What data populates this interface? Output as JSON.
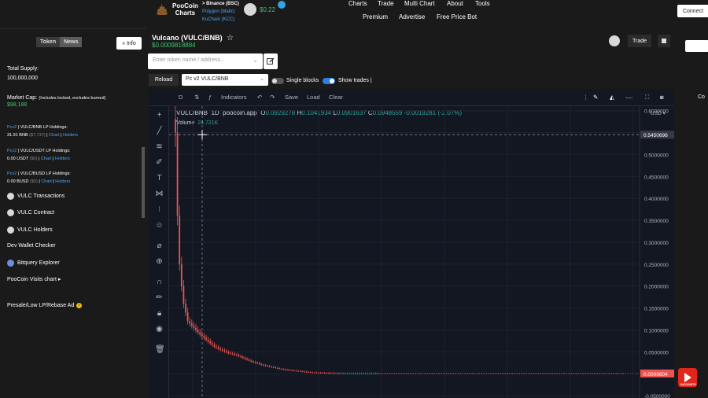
{
  "nav": {
    "logo_line1": "PooCoin",
    "logo_line2": "Charts",
    "chain_bsc": "> Binance (BSC)",
    "chain_polygon": "Polygon (Matic)",
    "chain_kucoin": "KuChain (KCC)",
    "poo_price": "$0.22",
    "links": [
      "Charts",
      "Trade",
      "Multi Chart",
      "About",
      "Tools",
      "Premium",
      "Advertise",
      "Free Price Bot"
    ],
    "connect_label": "Connect"
  },
  "sidebar": {
    "tab_token": "Token",
    "tab_news": "News",
    "info_label": "Info",
    "total_supply_label": "Total Supply:",
    "total_supply_value": "100,000,000",
    "market_cap_label": "Market Cap:",
    "market_cap_note": "(Includes locked, excludes burned)",
    "market_cap_value": "$98,188",
    "holdings": [
      {
        "version": "Pcv2",
        "pair": " | VULC/BNB LP Holdings:",
        "amount": "31.91 BNB",
        "usd": " ($7,737)",
        "chart": "Chart",
        "holders": "Holders"
      },
      {
        "version": "Pcv2",
        "pair": " | VULC/USDT LP Holdings:",
        "amount": "0.00 USDT",
        "usd": " ($0)",
        "chart": "Chart",
        "holders": "Holders"
      },
      {
        "version": "Pcv2",
        "pair": " | VULC/BUSD LP Holdings:",
        "amount": "0.00 BUSD",
        "usd": " ($0)",
        "chart": "Chart",
        "holders": "Holders"
      }
    ],
    "links": {
      "transactions": "VULC Transactions",
      "contract": "VULC Contract",
      "holders": "VULC Holders",
      "dev_wallet": "Dev Wallet Checker",
      "bitquery": "Bitquery Explorer",
      "visits": "PooCoin Visits chart",
      "presale": "Presale/Low LP/Rebase Ad"
    }
  },
  "header": {
    "token_title": "Vulcano (VULC/BNB)",
    "token_price": "$0.0009818884",
    "search_placeholder": "Enter token name / address...",
    "reload_label": "Reload",
    "pair_value": "Pc v2 VULC/BNB",
    "single_blocks_label": "Single blocks",
    "show_trades_label": "Show trades |",
    "trade_label": "Trade"
  },
  "right_panel": {
    "partial_text": "Co"
  },
  "video_badge": "INCOGNITO",
  "chart_toolbar": {
    "interval": "D",
    "indicators": "Indicators",
    "save": "Save",
    "load": "Load",
    "clear": "Clear"
  },
  "chart_data": {
    "type": "candlestick",
    "symbol": "VULC/BNB",
    "interval": "1D",
    "source": "poocoin.app",
    "ohlc": {
      "O": "0.0929278",
      "H": "0.1041934",
      "L": "0.0901637",
      "C": "0.0948559",
      "change": "-0.0019281 (-2.07%)"
    },
    "volume_label": "Volume",
    "volume_value": "24.721K",
    "y_axis_unit": "USD",
    "y_ticks": [
      0.6,
      0.55,
      0.5,
      0.45,
      0.4,
      0.35,
      0.3,
      0.25,
      0.2,
      0.15,
      0.1,
      0.05,
      0.0,
      -0.05
    ],
    "y_tick_labels": [
      "0.6000000",
      "0.5500000",
      "0.5000000",
      "0.4500000",
      "0.4000000",
      "0.3500000",
      "0.3000000",
      "0.2500000",
      "0.2000000",
      "0.1500000",
      "0.1000000",
      "0.0500000",
      "0.0000000",
      "-0.0500000"
    ],
    "ylim": [
      -0.055,
      0.61
    ],
    "crosshair_value": 0.5450696,
    "crosshair_label": "0.5450696",
    "last_price": 0.0009804,
    "last_price_label": "0.0009804",
    "series_close": [
      0.55,
      0.36,
      0.25,
      0.2,
      0.16,
      0.14,
      0.12,
      0.115,
      0.11,
      0.105,
      0.1,
      0.095,
      0.09,
      0.086,
      0.082,
      0.078,
      0.074,
      0.07,
      0.066,
      0.062,
      0.06,
      0.057,
      0.055,
      0.053,
      0.051,
      0.049,
      0.047,
      0.046,
      0.045,
      0.043,
      0.042,
      0.04,
      0.038,
      0.036,
      0.034,
      0.032,
      0.03,
      0.028,
      0.026,
      0.025,
      0.024,
      0.022,
      0.02,
      0.019,
      0.018,
      0.017,
      0.016,
      0.015,
      0.014,
      0.013,
      0.012,
      0.011,
      0.01,
      0.0095,
      0.009,
      0.0085,
      0.008,
      0.0075,
      0.007,
      0.0065,
      0.006,
      0.0055,
      0.005,
      0.0045,
      0.004,
      0.0035,
      0.003,
      0.0028,
      0.0026,
      0.0024,
      0.0022,
      0.002,
      0.0019,
      0.0018,
      0.0017,
      0.0016,
      0.0015,
      0.0014,
      0.0013,
      0.0012,
      0.0011,
      0.0011,
      0.001,
      0.001,
      0.001,
      0.001,
      0.001,
      0.001,
      0.001,
      0.001,
      0.001,
      0.001,
      0.001,
      0.001,
      0.001,
      0.001,
      0.001,
      0.001,
      0.001,
      0.001
    ]
  },
  "colors": {
    "accent_green": "#3ec46d",
    "link_blue": "#49a6ff",
    "chart_bg": "#131722",
    "candle_down": "#ef5350",
    "candle_up": "#26a69a",
    "last_price_tag": "#ef5350"
  }
}
